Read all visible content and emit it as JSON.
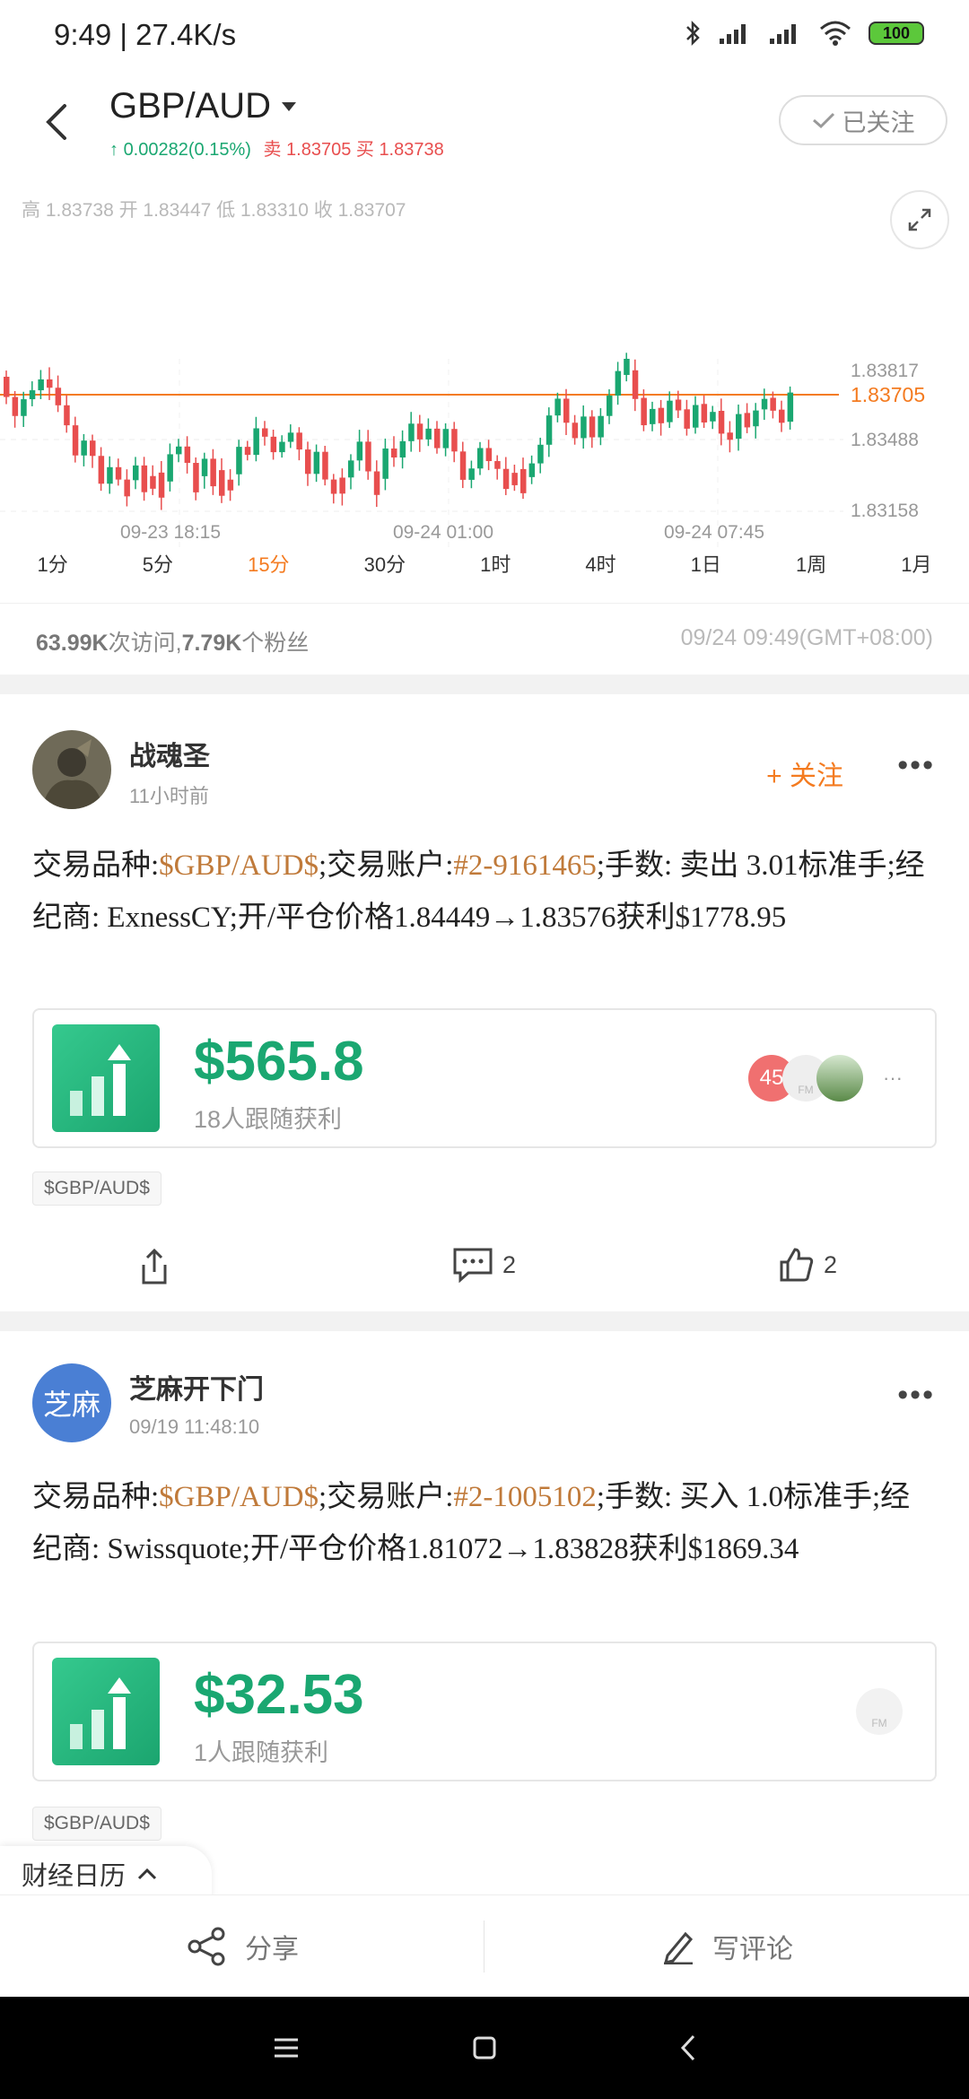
{
  "status": {
    "time": "9:49",
    "speed": "27.4K/s",
    "battery": "100"
  },
  "header": {
    "title": "GBP/AUD",
    "change": "0.00282(0.15%)",
    "sell_label": "卖",
    "sell": "1.83705",
    "buy_label": "买",
    "buy": "1.83738",
    "follow_label": "已关注"
  },
  "chart": {
    "ohlc": "高 1.83738  开 1.83447  低 1.83310  收 1.83707",
    "price_labels": [
      "1.83817",
      "1.83488",
      "1.83158"
    ],
    "current_price": "1.83705",
    "time_labels": [
      "09-23 18:15",
      "09-24 01:00",
      "09-24 07:45"
    ],
    "colors": {
      "up": "#1aa771",
      "down": "#e84e4e",
      "current_line": "#f47b20"
    }
  },
  "periods": [
    "1分",
    "5分",
    "15分",
    "30分",
    "1时",
    "4时",
    "1日",
    "1周",
    "1月"
  ],
  "active_period": "15分",
  "stats": {
    "visits": "63.99K",
    "visits_label": "次访问,",
    "fans": "7.79K",
    "fans_label": "个粉丝",
    "datetime": "09/24 09:49(GMT+08:00)"
  },
  "posts": [
    {
      "user": "战魂圣",
      "time": "11小时前",
      "follow": "+ 关注",
      "t1": "交易品种:",
      "symbol": "$GBP/AUD$",
      "t2": ";交易账户:",
      "account": "#2-9161465",
      "t3": ";手数: 卖出 3.01标准手;经纪商: ExnessCY;开/平仓价格1.84449→1.83576获利$1778.95",
      "profit": "$565.8",
      "followers": "18人跟随获利",
      "tag": "$GBP/AUD$",
      "comments": "2",
      "likes": "2",
      "avatar_badge": "45",
      "avatar_fm": "FM",
      "more_followers": "···"
    },
    {
      "user": "芝麻开下门",
      "avatar_text": "芝麻",
      "time": "09/19 11:48:10",
      "t1": "交易品种:",
      "symbol": "$GBP/AUD$",
      "t2": ";交易账户:",
      "account": "#2-1005102",
      "t3": ";手数: 买入 1.0标准手;经纪商: Swissquote;开/平仓价格1.81072→1.83828获利$1869.34",
      "profit": "$32.53",
      "followers": "1人跟随获利",
      "tag": "$GBP/AUD$",
      "avatar_fm": "FM"
    }
  ],
  "calendar_tab": "财经日历",
  "bottom": {
    "share": "分享",
    "comment": "写评论"
  }
}
